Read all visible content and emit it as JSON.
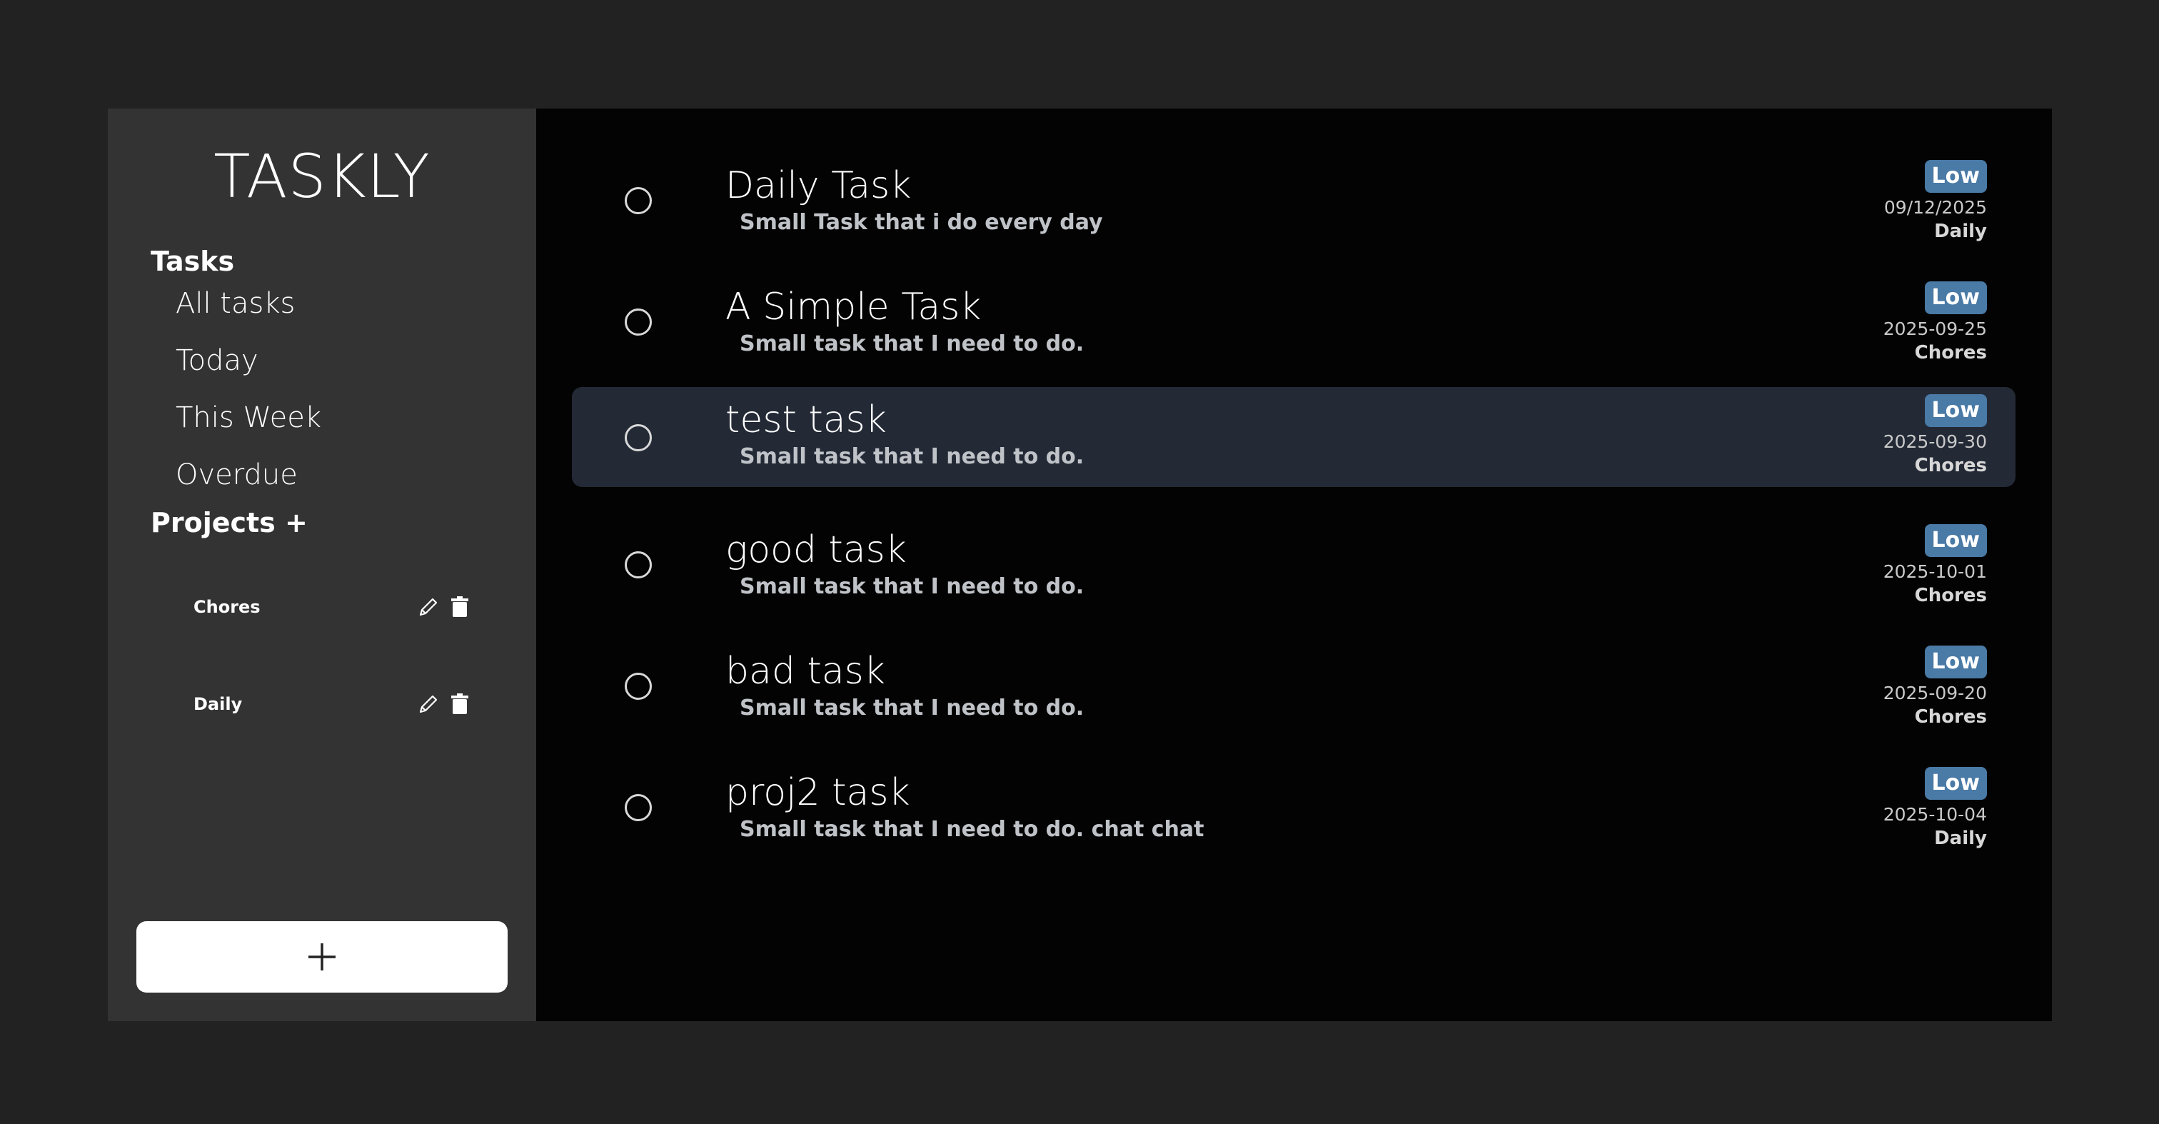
{
  "app": {
    "title": "TASKLY"
  },
  "sidebar": {
    "tasks_heading": "Tasks",
    "nav": [
      {
        "label": "All tasks"
      },
      {
        "label": "Today"
      },
      {
        "label": "This Week"
      },
      {
        "label": "Overdue"
      }
    ],
    "projects_heading": "Projects +",
    "projects": [
      {
        "name": "Chores",
        "edit_icon": "pencil-icon",
        "delete_icon": "trash-icon"
      },
      {
        "name": "Daily",
        "edit_icon": "pencil-icon",
        "delete_icon": "trash-icon"
      }
    ],
    "add_button_icon": "plus-icon"
  },
  "tasks": [
    {
      "title": "Daily Task",
      "description": "Small Task that i do every day",
      "priority": "Low",
      "due": "09/12/2025",
      "project": "Daily",
      "selected": false
    },
    {
      "title": "A Simple Task",
      "description": "Small task that I need to do.",
      "priority": "Low",
      "due": "2025-09-25",
      "project": "Chores",
      "selected": false
    },
    {
      "title": "test task",
      "description": "Small task that I need to do.",
      "priority": "Low",
      "due": "2025-09-30",
      "project": "Chores",
      "selected": true
    },
    {
      "title": "good task",
      "description": "Small task that I need to do.",
      "priority": "Low",
      "due": "2025-10-01",
      "project": "Chores",
      "selected": false
    },
    {
      "title": "bad task",
      "description": "Small task that I need to do.",
      "priority": "Low",
      "due": "2025-09-20",
      "project": "Chores",
      "selected": false
    },
    {
      "title": "proj2 task",
      "description": "Small task that I need to do. chat chat",
      "priority": "Low",
      "due": "2025-10-04",
      "project": "Daily",
      "selected": false
    }
  ],
  "colors": {
    "background": "#222222",
    "sidebar": "#333333",
    "main": "#030303",
    "selected_row": "#232a36",
    "priority_badge": "#4a7aa6"
  }
}
